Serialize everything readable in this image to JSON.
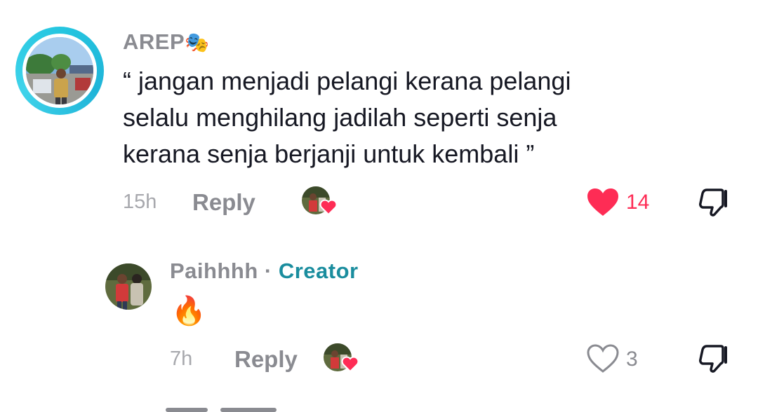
{
  "comment": {
    "username": "AREP",
    "username_emoji": "🎭",
    "text_lines": [
      "“ jangan menjadi pelangi kerana pelangi",
      "selalu menghilang jadilah seperti senja",
      "kerana senja berjanji untuk kembali ”"
    ],
    "time": "15h",
    "reply_label": "Reply",
    "like_count": "14",
    "liked": true,
    "colors": {
      "like_active": "#fe2c55",
      "avatar_ring": "#25c6e0"
    }
  },
  "reply": {
    "username": "Paihhhh",
    "separator": "·",
    "creator_label": "Creator",
    "text": "🔥",
    "time": "7h",
    "reply_label": "Reply",
    "like_count": "3",
    "liked": false,
    "colors": {
      "creator": "#1a8d9e"
    }
  },
  "icons": {
    "avatar": "user-photo",
    "creator_liked_badge": "heart-icon",
    "like": "heart-icon",
    "dislike": "thumbs-down-icon",
    "fire": "fire-emoji"
  }
}
